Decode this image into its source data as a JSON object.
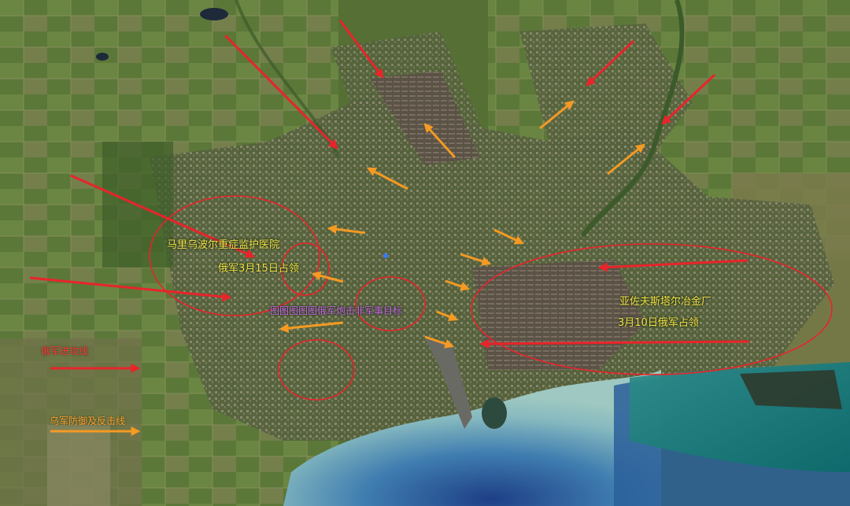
{
  "annotations": {
    "hospital_name": "马里乌波尔重症监护医院",
    "hospital_captured": "俄军3月15日占领",
    "residential_note": "图图图图图俄军炮击非军事目标",
    "plant_name": "亚佐夫斯塔尔冶金厂",
    "plant_captured": "3月10日俄军占领"
  },
  "legend": {
    "russian_advance": "俄军进攻线",
    "ukraine_defense": "乌军防御及反击线"
  },
  "colors": {
    "russian_arrow": "#e8242a",
    "ukraine_arrow": "#f59a22",
    "circle": "#e8242a",
    "label_yellow": "#f4e24a",
    "label_violet": "#c66ae6"
  }
}
